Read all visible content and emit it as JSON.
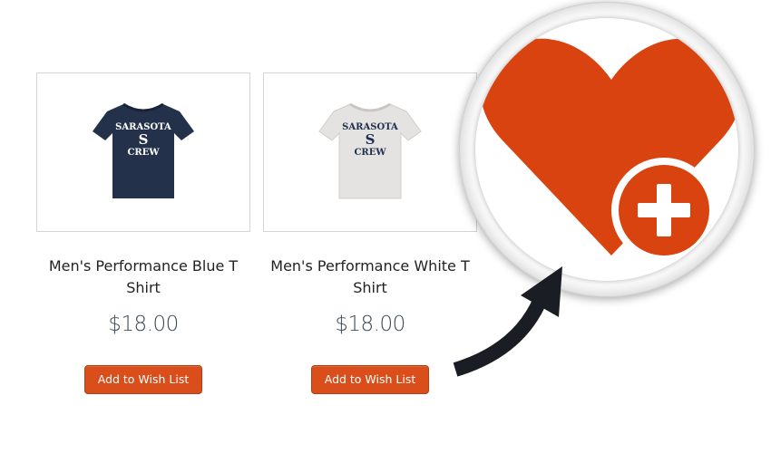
{
  "products": [
    {
      "name": "Men's Performance Blue T Shirt",
      "price": "$18.00",
      "button_label": "Add to Wish List",
      "shirt_color": "#23324a",
      "print_color": "#ffffff",
      "print_lines": [
        "SARASOTA",
        "S",
        "CREW"
      ]
    },
    {
      "name": "Men's Performance White T Shirt",
      "price": "$18.00",
      "button_label": "Add to Wish List",
      "shirt_color": "#e4e3e1",
      "print_color": "#1f2f4f",
      "print_lines": [
        "SARASOTA",
        "S",
        "CREW"
      ]
    }
  ],
  "colors": {
    "accent": "#d94e1b",
    "heart": "#d84310",
    "arrow": "#1a1d24"
  },
  "callout": {
    "icon": "heart-plus-icon"
  }
}
